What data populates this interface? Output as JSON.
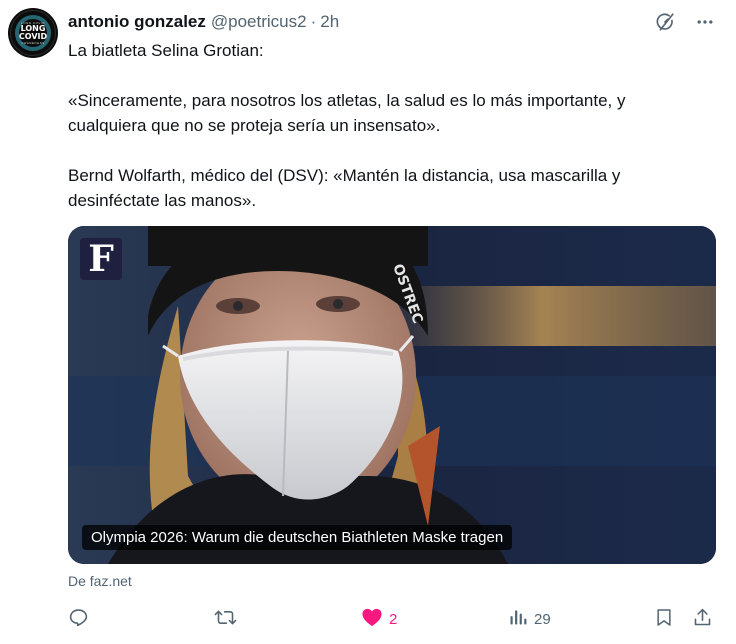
{
  "post": {
    "author_name": "antonio gonzalez",
    "author_handle": "@poetricus2",
    "separator": "·",
    "time": "2h",
    "avatar": {
      "top_text": "LONG COVID",
      "line1": "LONG",
      "line2": "COVID",
      "bottom_text": "AWARENESS"
    },
    "text": [
      "La biatleta Selina Grotian:",
      "«Sinceramente, para nosotros los atletas, la salud es lo más importante, y cualquiera que no se proteja sería un insensato».",
      "Bernd Wolfarth, médico del (DSV): «Mantén la distancia, usa mascarilla y desinféctate las manos»."
    ],
    "card": {
      "logo_letter": "F",
      "caption": "Olympia 2026: Warum die deutschen Biathleten Maske tragen",
      "jacket_text": "OSTREC"
    },
    "source": "De faz.net"
  },
  "actions": {
    "reply_count": "",
    "repost_count": "",
    "like_count": "2",
    "views_count": "29"
  },
  "icons": {
    "grok": "grok-icon",
    "more": "more-icon",
    "reply": "reply-icon",
    "repost": "repost-icon",
    "like": "heart-icon",
    "views": "views-icon",
    "bookmark": "bookmark-icon",
    "share": "share-icon"
  },
  "colors": {
    "text": "#0f1419",
    "muted": "#536471",
    "like": "#f91880"
  }
}
